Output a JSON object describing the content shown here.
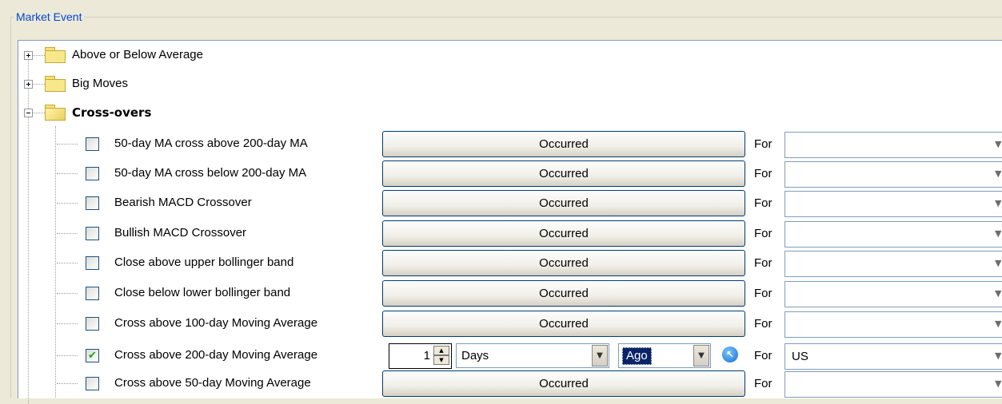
{
  "group": {
    "title": "Market Event"
  },
  "categories": [
    {
      "label": "Above or Below Average",
      "expanded": false
    },
    {
      "label": "Big Moves",
      "expanded": false
    },
    {
      "label": "Cross-overs",
      "expanded": true
    }
  ],
  "items": [
    {
      "label": "50-day MA cross above 200-day MA",
      "checked": false,
      "button": "Occurred",
      "for": "For",
      "market": ""
    },
    {
      "label": "50-day MA cross below 200-day MA",
      "checked": false,
      "button": "Occurred",
      "for": "For",
      "market": ""
    },
    {
      "label": "Bearish MACD Crossover",
      "checked": false,
      "button": "Occurred",
      "for": "For",
      "market": ""
    },
    {
      "label": "Bullish MACD Crossover",
      "checked": false,
      "button": "Occurred",
      "for": "For",
      "market": ""
    },
    {
      "label": "Close above upper bollinger band",
      "checked": false,
      "button": "Occurred",
      "for": "For",
      "market": ""
    },
    {
      "label": "Close below lower bollinger band",
      "checked": false,
      "button": "Occurred",
      "for": "For",
      "market": ""
    },
    {
      "label": "Cross above 100-day Moving Average",
      "checked": false,
      "button": "Occurred",
      "for": "For",
      "market": ""
    },
    {
      "label": "Cross above 200-day Moving Average",
      "checked": true,
      "count": "1",
      "unit": "Days",
      "relation": "Ago",
      "for": "For",
      "market": "US"
    },
    {
      "label": "Cross above 50-day Moving Average",
      "checked": false,
      "button": "Occurred",
      "for": "For",
      "market": ""
    }
  ],
  "icons": {
    "expand": "plus-box-icon",
    "collapse": "minus-box-icon",
    "folder": "folder-icon",
    "check": "checkmark-icon",
    "reset": "reset-arrow-icon",
    "dropdown": "chevron-down-icon"
  },
  "colors": {
    "title": "#0046d5",
    "window_bg": "#ece9d8",
    "selection": "#0a246a",
    "checkmark": "#21a121"
  }
}
